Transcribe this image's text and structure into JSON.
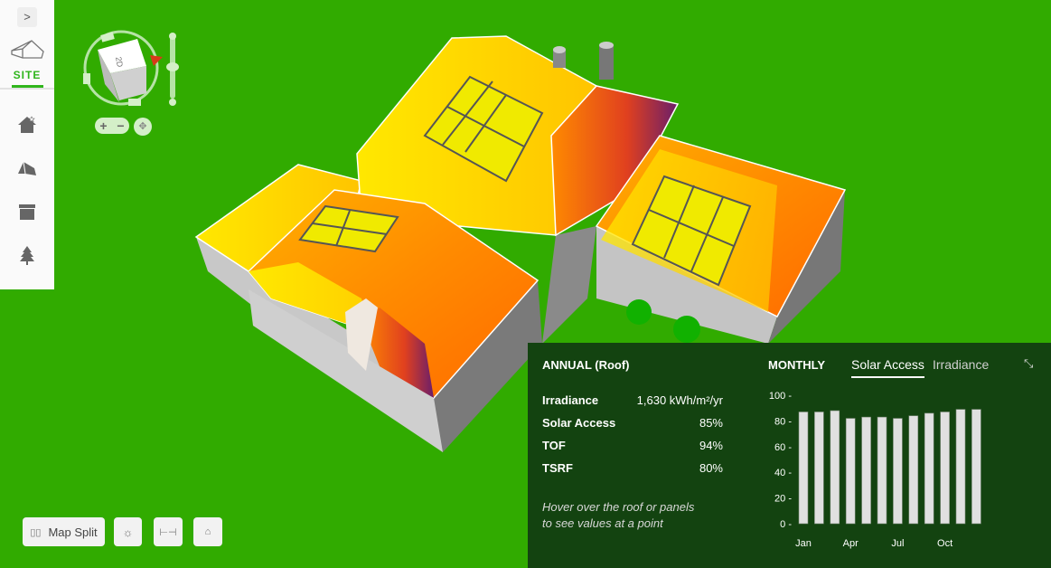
{
  "sidebar": {
    "toggle": ">",
    "site_label": "SITE",
    "items": [
      {
        "icon": "home-star-icon"
      },
      {
        "icon": "roof-icon"
      },
      {
        "icon": "obstruction-icon"
      },
      {
        "icon": "tree-icon"
      }
    ]
  },
  "nav": {
    "cube_label": "2D",
    "zoom_in": "+",
    "zoom_out": "−"
  },
  "toolbar": {
    "map_split_label": "Map Split"
  },
  "annual": {
    "title": "ANNUAL (Roof)",
    "rows": [
      {
        "label": "Irradiance",
        "value": "1,630 kWh/m²/yr"
      },
      {
        "label": "Solar Access",
        "value": "85%"
      },
      {
        "label": "TOF",
        "value": "94%"
      },
      {
        "label": "TSRF",
        "value": "80%"
      }
    ],
    "hint_line1": "Hover over the roof or panels",
    "hint_line2": "to see values at a point"
  },
  "monthly": {
    "title": "MONTHLY",
    "tabs": [
      {
        "label": "Solar Access",
        "active": true
      },
      {
        "label": "Irradiance",
        "active": false
      }
    ]
  },
  "colors": {
    "background": "#31ab00",
    "panel": "#134310",
    "accent": "#2fb51c",
    "bar": "#e0e0e0"
  },
  "chart_data": {
    "type": "bar",
    "categories": [
      "Jan",
      "Feb",
      "Mar",
      "Apr",
      "May",
      "Jun",
      "Jul",
      "Aug",
      "Sep",
      "Oct",
      "Nov",
      "Dec"
    ],
    "tick_labels_x": [
      "Jan",
      "Apr",
      "Jul",
      "Oct"
    ],
    "values": [
      87,
      87,
      88,
      82,
      83,
      83,
      82,
      84,
      86,
      87,
      89,
      89
    ],
    "yticks": [
      0,
      20,
      40,
      60,
      80,
      100
    ],
    "ylim": [
      0,
      100
    ],
    "title": "",
    "xlabel": "",
    "ylabel": ""
  }
}
